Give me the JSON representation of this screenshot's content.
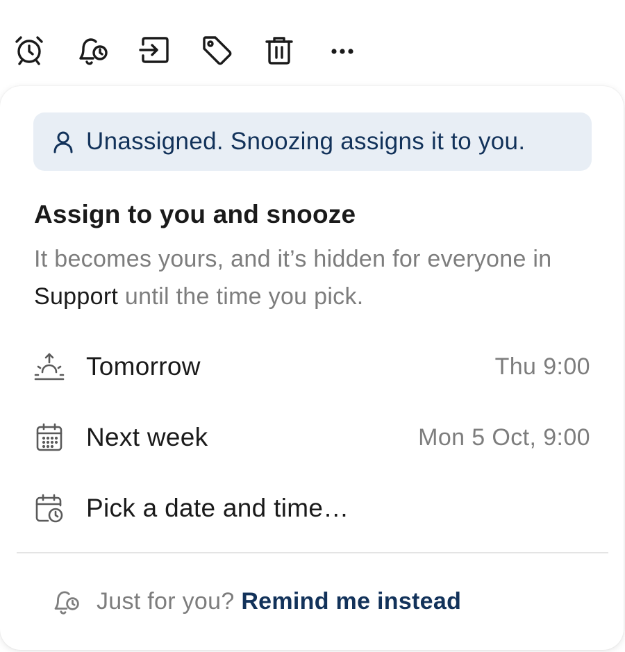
{
  "toolbar": {
    "icons": [
      "alarm-clock-icon",
      "bell-clock-icon",
      "move-to-icon",
      "tag-icon",
      "trash-icon",
      "more-icon"
    ]
  },
  "banner": {
    "icon": "person-icon",
    "text": "Unassigned. Snoozing assigns it to you."
  },
  "heading": {
    "title": "Assign to you and snooze",
    "desc_part1": "It becomes yours, and it’s hidden for everyone in ",
    "desc_team": "Support",
    "desc_part2": " until the time you pick."
  },
  "options": [
    {
      "icon": "sunrise-icon",
      "label": "Tomorrow",
      "time": "Thu 9:00"
    },
    {
      "icon": "calendar-icon",
      "label": "Next week",
      "time": "Mon 5 Oct, 9:00"
    },
    {
      "icon": "calendar-clock-icon",
      "label": "Pick a date and time…",
      "time": ""
    }
  ],
  "footer": {
    "icon": "bell-clock-icon",
    "prompt": "Just for you? ",
    "link": "Remind me instead"
  },
  "colors": {
    "banner_bg": "#e8eef5",
    "accent_text": "#12325a",
    "muted_text": "#7d7d7d",
    "primary_text": "#1a1a1a"
  }
}
